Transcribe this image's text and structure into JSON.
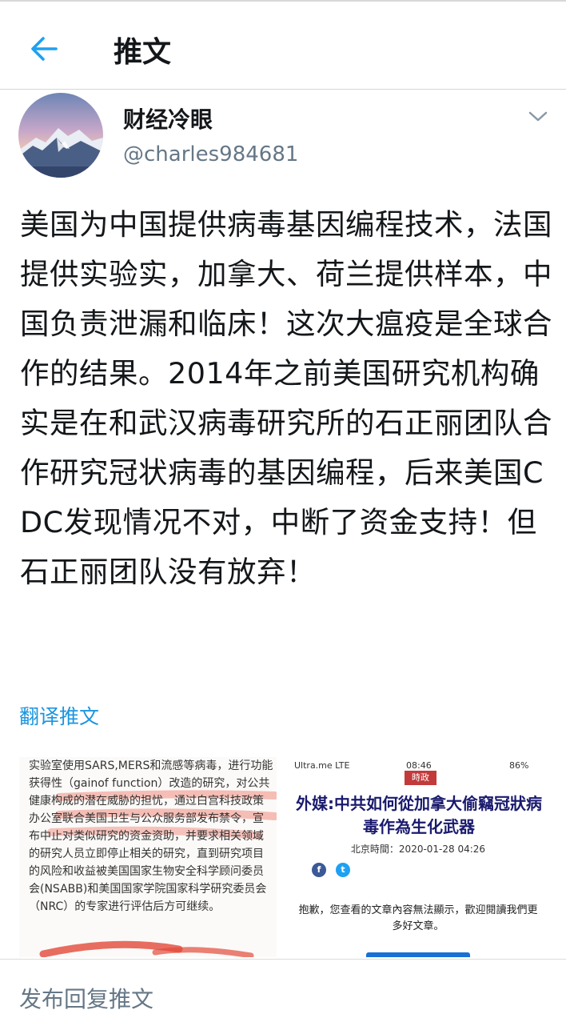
{
  "header": {
    "title": "推文"
  },
  "tweet": {
    "display_name": "财经冷眼",
    "handle": "@charles984681",
    "text": "美国为中国提供病毒基因编程技术，法国提供实验实，加拿大、荷兰提供样本，中国负责泄漏和临床！这次大瘟疫是全球合作的结果。2014年之前美国研究机构确实是在和武汉病毒研究所的石正丽团队合作研究冠状病毒的基因编程，后来美国CDC发现情况不对，中断了资金支持！但石正丽团队没有放弃！",
    "translate_label": "翻译推文"
  },
  "media": {
    "image1_text": "实验室使用SARS,MERS和流感等病毒，进行功能获得性（gainof function）改造的研究，对公共健康构成的潜在威胁的担忧，通过白宫科技政策办公室联合美国卫生与公众服务部发布禁令，宣布中止对类似研究的资金资助，并要求相关领域的研究人员立即停止相关的研究，直到研究项目的风险和收益被美国国家生物安全科学顾问委员会(NSABB)和美国国家学院国家科学研究委员会（NRC）的专家进行评估后方可继续。",
    "image2": {
      "status_left": "Ultra.me LTE",
      "status_time": "08:46",
      "status_battery": "86%",
      "tag": "時政",
      "title": "外媒:中共如何從加拿大偷竊冠狀病毒作為生化武器",
      "time": "北京時間：2020-01-28 04:26",
      "message": "抱歉，您查看的文章內容無法顯示，歡迎閱讀我們更多好文章。"
    }
  },
  "footer": {
    "reply_placeholder": "发布回复推文"
  },
  "colors": {
    "link": "#1b95e0",
    "secondary": "#657786",
    "accent_red": "#c23a3a"
  }
}
